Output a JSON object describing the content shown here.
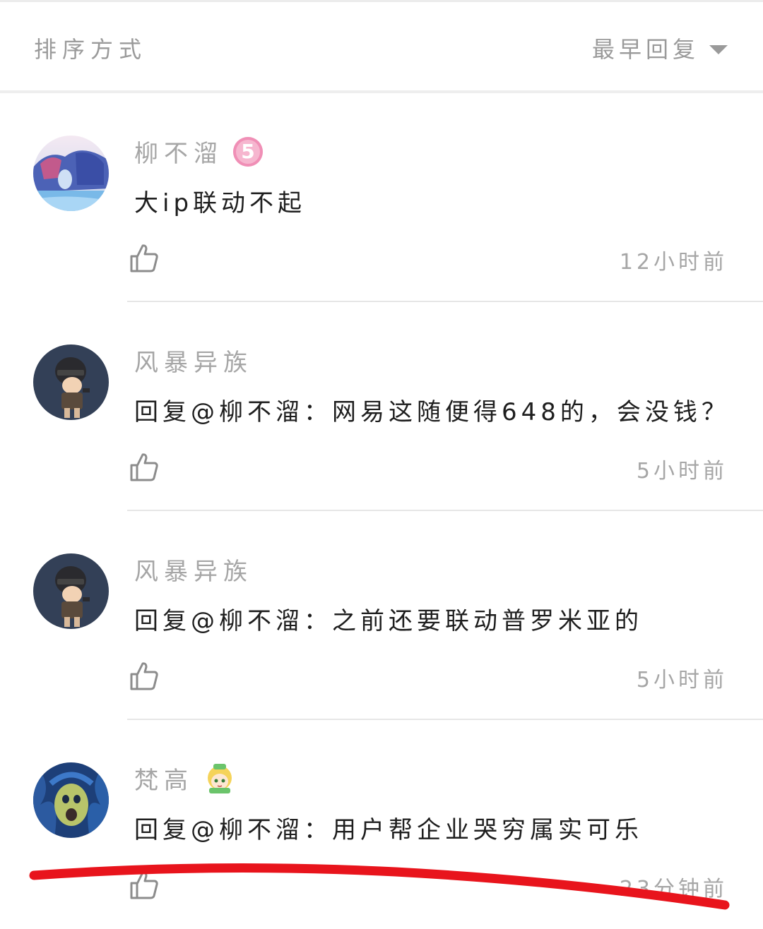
{
  "sort": {
    "label": "排序方式",
    "selected": "最早回复"
  },
  "comments": [
    {
      "username": "柳不溜",
      "badge": "5",
      "content": "大ip联动不起",
      "time": "12小时前",
      "avatar": "landscape-avatar"
    },
    {
      "username": "风暴异族",
      "content": "回复@柳不溜：网易这随便得648的，会没钱？",
      "time": "5小时前",
      "avatar": "soldier-avatar"
    },
    {
      "username": "风暴异族",
      "content": "回复@柳不溜：之前还要联动普罗米亚的",
      "time": "5小时前",
      "avatar": "soldier-avatar"
    },
    {
      "username": "梵高",
      "content": "回复@柳不溜：用户帮企业哭穷属实可乐",
      "time": "23分钟前",
      "avatar": "painting-avatar",
      "badge_icon": "cartoon-girl-icon"
    }
  ],
  "colors": {
    "annotation": "#e8141c",
    "muted_text": "#a6a6a6"
  }
}
